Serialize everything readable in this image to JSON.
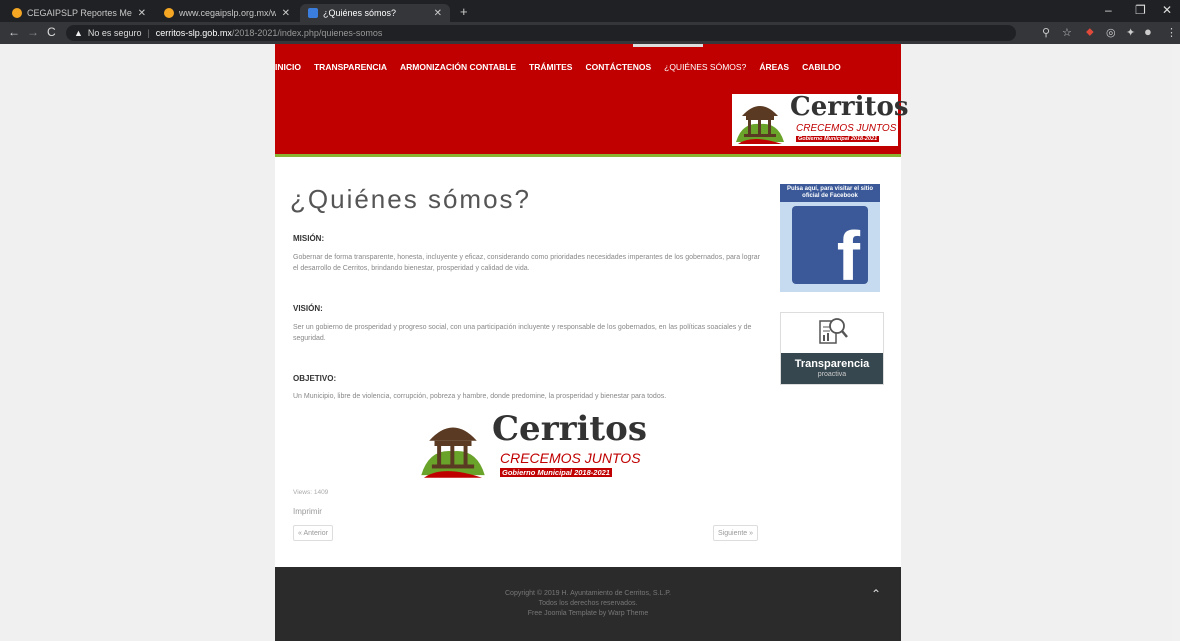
{
  "browser": {
    "tabs": [
      {
        "title": "CEGAIPSLP Reportes Mensuales",
        "active": false,
        "favicon_color": "#f5a623"
      },
      {
        "title": "www.cegaipslp.org.mx/webcega...",
        "active": false,
        "favicon_color": "#f5a623"
      },
      {
        "title": "¿Quiénes sómos?",
        "active": true,
        "favicon_color": "#3b7ddd"
      }
    ],
    "new_tab": "+",
    "window_controls": [
      "–",
      "❐",
      "✕"
    ],
    "security_label": "No es seguro",
    "url_host": "cerritos-slp.gob.mx",
    "url_path": "/2018-2021/index.php/quienes-somos"
  },
  "nav": {
    "items": [
      "INICIO",
      "TRANSPARENCIA",
      "ARMONIZACIÓN CONTABLE",
      "TRÁMITES",
      "CONTÁCTENOS",
      "¿QUIÉNES SÓMOS?",
      "ÁREAS",
      "CABILDO"
    ],
    "active_index": 5
  },
  "logo": {
    "word": "Cerritos",
    "tagline": "CRECEMOS JUNTOS",
    "subline": "Gobierno Municipal 2018-2021"
  },
  "content": {
    "title": "¿Quiénes sómos?",
    "mision_heading": "MISIÓN:",
    "mision_text": "Gobernar de forma transparente, honesta, incluyente y eficaz, considerando como prioridades necesidades imperantes de los gobernados, para lograr el desarrollo de Cerritos, brindando bienestar, prosperidad y calidad de vida.",
    "vision_heading": "VISIÓN:",
    "vision_text": "Ser un gobierno de prosperidad y progreso social, con una participación incluyente y responsable de los gobernados, en las políticas soaciales y de seguridad.",
    "objetivo_heading": "OBJETIVO:",
    "objetivo_text": "Un Municipio, libre de violencia, corrupción, pobreza y hambre, donde predomine, la prosperidad y bienestar para todos.",
    "views": "Views: 1409",
    "print": "Imprimir",
    "prev": "« Anterior",
    "next": "Siguiente »"
  },
  "sidebar": {
    "facebook_text": "Pulsa aquí, para visitar el sitio oficial de Facebook",
    "facebook_letter": "f",
    "transparencia_title": "Transparencia",
    "transparencia_sub": "proactiva"
  },
  "footer": {
    "line1": "Copyright © 2019 H. Ayuntamiento de Cerritos, S.L.P.",
    "line2": "Todos los derechos reservados.",
    "line3": "Free Joomla Template by Warp Theme",
    "to_top": "⌃"
  },
  "colors": {
    "header_red": "#c00000",
    "accent_green": "#8ab333",
    "footer_dark": "#2b2b2b"
  }
}
